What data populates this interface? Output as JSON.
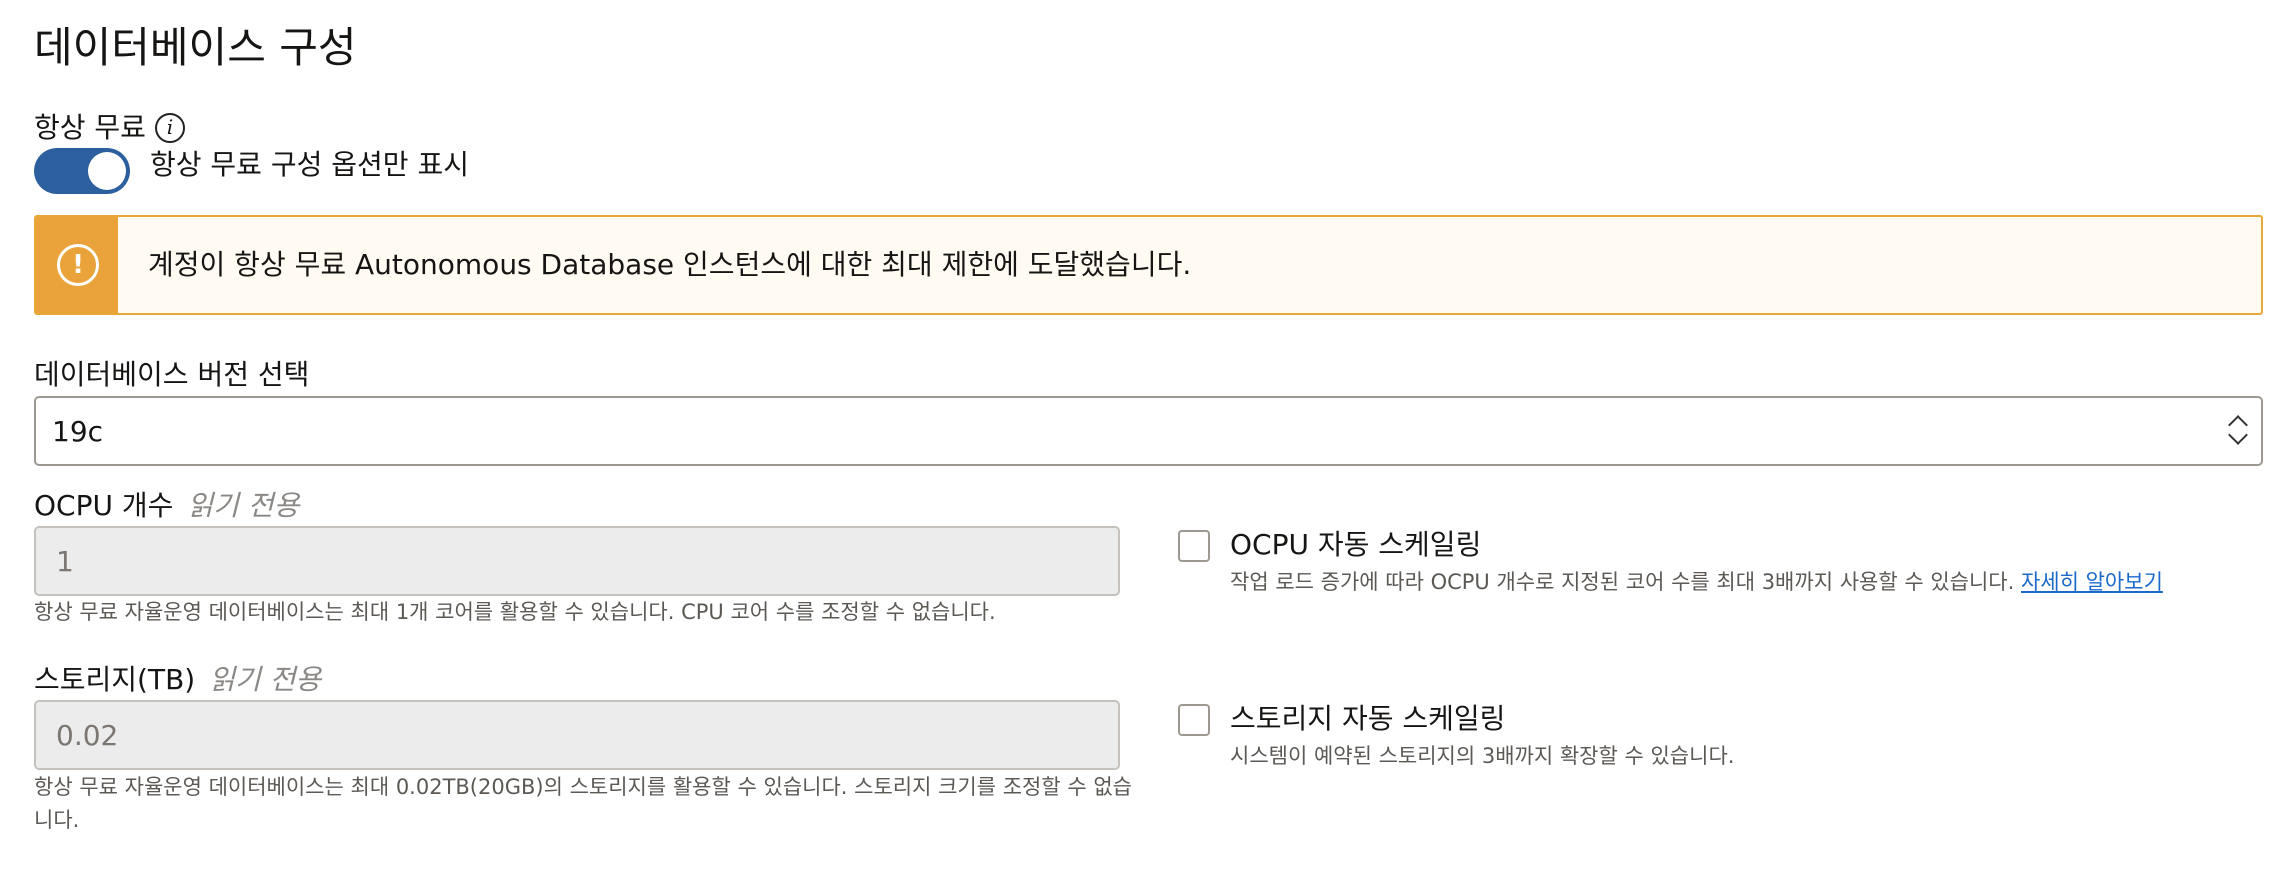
{
  "page": {
    "title": "데이터베이스 구성"
  },
  "always_free": {
    "label": "항상 무료",
    "info_icon": "info-icon",
    "toggle_label": "항상 무료 구성 옵션만 표시",
    "toggle_on": true
  },
  "alert": {
    "icon": "warning-icon",
    "text": "계정이 항상 무료 Autonomous Database 인스턴스에 대한 최대 제한에 도달했습니다.",
    "accent_color": "#e9a33a"
  },
  "db_version": {
    "label": "데이터베이스 버전 선택",
    "value": "19c"
  },
  "ocpu": {
    "label": "OCPU 개수",
    "read_only": "읽기 전용",
    "value": "1",
    "help": "항상 무료 자율운영 데이터베이스는 최대 1개 코어를 활용할 수 있습니다. CPU 코어 수를 조정할 수 없습니다.",
    "autoscale_label": "OCPU 자동 스케일링",
    "autoscale_desc": "작업 로드 증가에 따라 OCPU 개수로 지정된 코어 수를 최대 3배까지 사용할 수 있습니다.",
    "learn_more": "자세히 알아보기"
  },
  "storage": {
    "label": "스토리지(TB)",
    "read_only": "읽기 전용",
    "value": "0.02",
    "help_line1": "항상 무료 자율운영 데이터베이스는 최대 0.02TB(20GB)의 스토리지를 활용할 수 있습니다. 스토리지 크기를 조정할 수 없습",
    "help_line2": "니다.",
    "autoscale_label": "스토리지 자동 스케일링",
    "autoscale_desc": "시스템이 예약된 스토리지의 3배까지 확장할 수 있습니다."
  },
  "colors": {
    "toggle": "#2c5f9e",
    "link": "#1b6ac9"
  }
}
